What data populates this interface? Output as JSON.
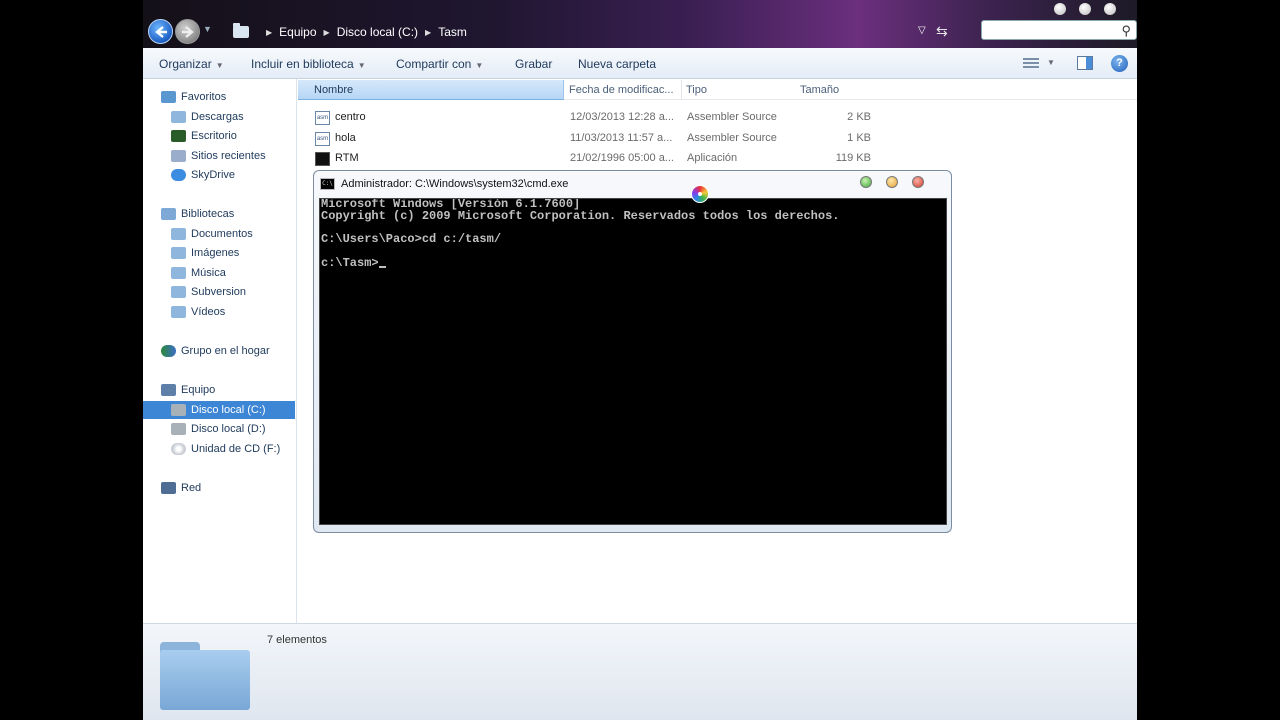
{
  "address": {
    "breadcrumb": [
      "Equipo",
      "Disco local (C:)",
      "Tasm"
    ],
    "search_placeholder": ""
  },
  "toolbar": {
    "organize": "Organizar",
    "include_library": "Incluir en biblioteca",
    "share": "Compartir con",
    "burn": "Grabar",
    "new_folder": "Nueva carpeta"
  },
  "nav": {
    "favorites": "Favoritos",
    "downloads": "Descargas",
    "desktop": "Escritorio",
    "recent": "Sitios recientes",
    "skydrive": "SkyDrive",
    "libraries": "Bibliotecas",
    "documents": "Documentos",
    "images": "Imágenes",
    "music": "Música",
    "subversion": "Subversion",
    "videos": "Vídeos",
    "homegroup": "Grupo en el hogar",
    "computer": "Equipo",
    "drive_c": "Disco local (C:)",
    "drive_d": "Disco local (D:)",
    "cd_drive": "Unidad de CD (F:)",
    "network": "Red"
  },
  "columns": {
    "name": "Nombre",
    "date": "Fecha de modificac...",
    "type": "Tipo",
    "size": "Tamaño"
  },
  "files": [
    {
      "name": "centro",
      "date": "12/03/2013 12:28 a...",
      "type": "Assembler Source",
      "size": "2 KB",
      "icon": "asm-file-icon"
    },
    {
      "name": "hola",
      "date": "11/03/2013 11:57 a...",
      "type": "Assembler Source",
      "size": "1 KB",
      "icon": "asm-file-icon"
    },
    {
      "name": "RTM",
      "date": "21/02/1996 05:00 a...",
      "type": "Aplicación",
      "size": "119 KB",
      "icon": "exe-file-icon"
    }
  ],
  "status": {
    "count": "7 elementos"
  },
  "cmd": {
    "title": "Administrador: C:\\Windows\\system32\\cmd.exe",
    "output": "Microsoft Windows [Versión 6.1.7600]\nCopyright (c) 2009 Microsoft Corporation. Reservados todos los derechos.\n\nC:\\Users\\Paco>cd c:/tasm/\n\nc:\\Tasm>"
  }
}
